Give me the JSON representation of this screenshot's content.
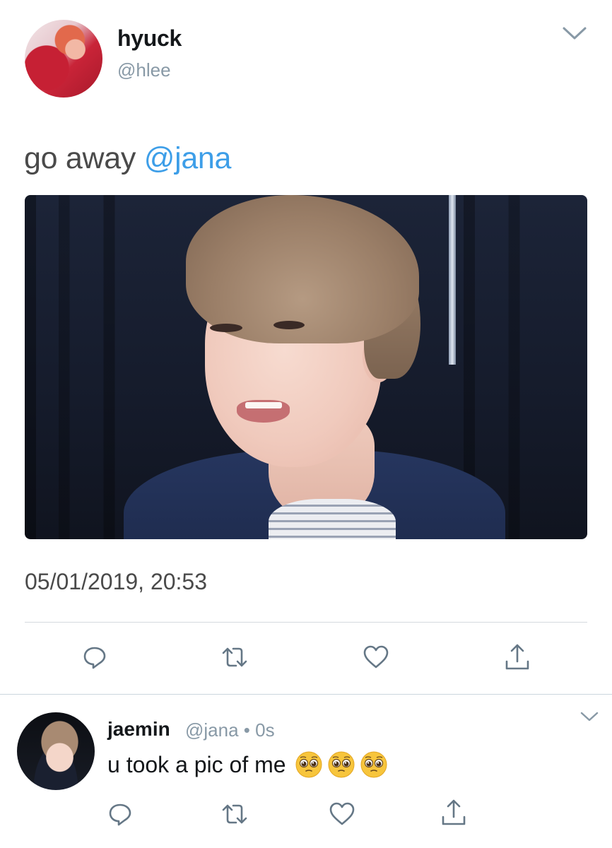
{
  "tweet": {
    "author": {
      "display_name": "hyuck",
      "handle": "@hlee",
      "avatar": "avatar"
    },
    "text_prefix": "go away ",
    "mention": "@jana",
    "media": "photo",
    "timestamp": "05/01/2019, 20:53",
    "actions": {
      "reply": "reply-icon",
      "retweet": "retweet-icon",
      "like": "heart-icon",
      "share": "share-icon"
    }
  },
  "reply": {
    "author": {
      "display_name": "jaemin",
      "handle": "@jana",
      "separator": "•",
      "time": "0s"
    },
    "text": "u took a pic of me",
    "emojis": [
      "pleading-face-emoji",
      "pleading-face-emoji",
      "pleading-face-emoji"
    ]
  },
  "colors": {
    "link": "#3d9ee8",
    "secondary_text": "#8899a6",
    "icon": "#657786",
    "divider": "#d4d9de"
  }
}
